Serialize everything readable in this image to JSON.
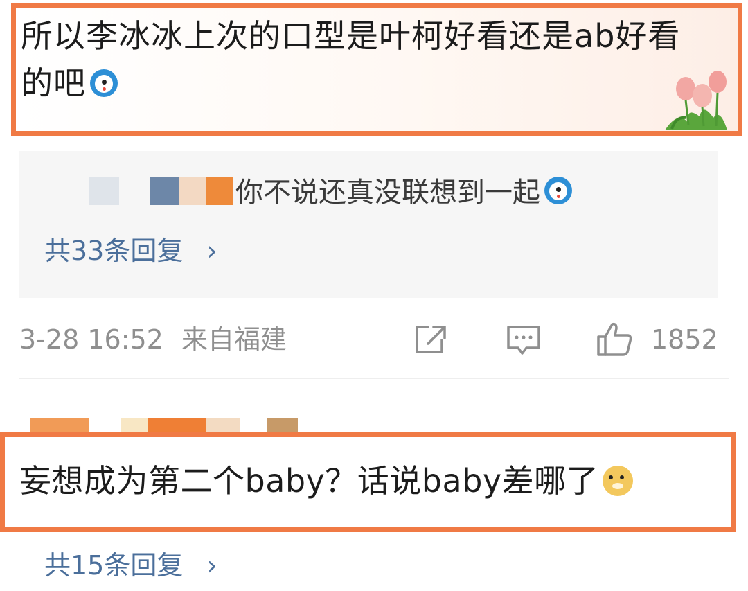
{
  "comment1": {
    "text": "所以李冰冰上次的口型是叶柯好看还是ab好看的吧",
    "emoji": "doraemon-face-emoji"
  },
  "reply_preview": {
    "text": "你不说还真没联想到一起",
    "emoji": "doraemon-face-emoji",
    "reply_count_label": "共33条回复",
    "chevron": "›"
  },
  "meta": {
    "timestamp": "3-28 16:52",
    "location": "来自福建",
    "icons": [
      "share-icon",
      "comment-icon",
      "like-icon"
    ],
    "like_count": "1852"
  },
  "comment2": {
    "text": "妄想成为第二个baby？话说baby差哪了",
    "emoji": "doge-emoji",
    "reply_count_label": "共15条回复",
    "chevron": "›"
  },
  "colors": {
    "highlight_border": "#f07a45",
    "link_blue": "#4b6f9b",
    "meta_gray": "#8f8f8f",
    "reply_bg": "#f6f6f6"
  }
}
